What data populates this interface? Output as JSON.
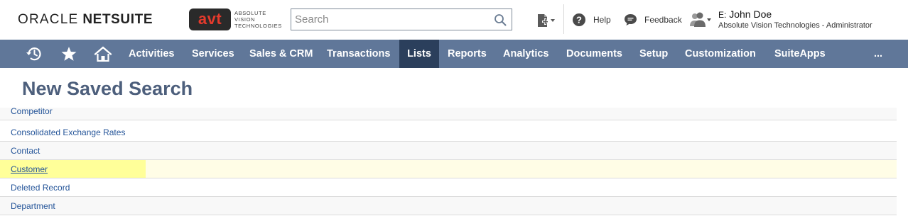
{
  "header": {
    "logo_word1": "ORACLE",
    "logo_word2": "NETSUITE",
    "company_badge": "avt",
    "company_tagline": [
      "ABSOLUTE",
      "VISION",
      "TECHNOLOGIES"
    ],
    "search": {
      "placeholder": "Search",
      "value": "",
      "icon": "search-icon"
    },
    "create_icon": "create-new-icon",
    "help_label": "Help",
    "help_icon": "question-circle-icon",
    "feedback_label": "Feedback",
    "feedback_icon": "speech-bubble-icon",
    "user_icon": "user-group-icon",
    "user_prefix": "E:",
    "user_name": "John Doe",
    "user_role": "Absolute Vision Technologies - Administrator"
  },
  "nav": {
    "icons": [
      "recent-records-icon",
      "star-icon",
      "home-icon"
    ],
    "items": [
      {
        "label": "Activities"
      },
      {
        "label": "Services"
      },
      {
        "label": "Sales & CRM"
      },
      {
        "label": "Transactions"
      },
      {
        "label": "Lists"
      },
      {
        "label": "Reports"
      },
      {
        "label": "Analytics"
      },
      {
        "label": "Documents"
      },
      {
        "label": "Setup"
      },
      {
        "label": "Customization"
      },
      {
        "label": "SuiteApps"
      }
    ],
    "active": "Lists",
    "more_label": "..."
  },
  "page": {
    "title": "New Saved Search"
  },
  "records": [
    {
      "label": "Competitor"
    },
    {
      "label": "Consolidated Exchange Rates"
    },
    {
      "label": "Contact"
    },
    {
      "label": "Customer"
    },
    {
      "label": "Deleted Record"
    },
    {
      "label": "Department"
    }
  ],
  "selected_record": "Customer",
  "colors": {
    "nav_bg": "#607799",
    "nav_active_bg": "#2b3f5c",
    "title_color": "#4d5f7c",
    "link_color": "#255599",
    "highlight": "#ffff99",
    "badge_red": "#e53a2c"
  }
}
